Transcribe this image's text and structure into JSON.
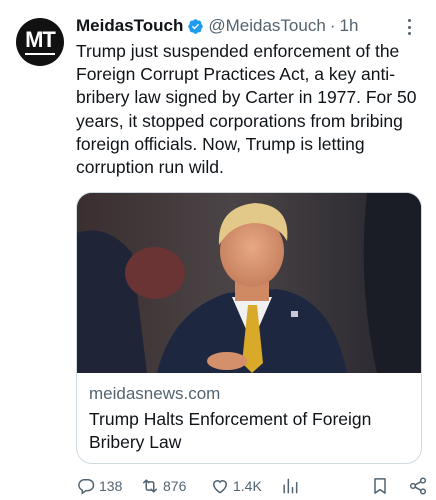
{
  "author": {
    "name": "MeidasTouch",
    "handle": "@MeidasTouch",
    "separator": "·",
    "time": "1h",
    "avatar_text": "MT",
    "verified_color": "#1d9bf0"
  },
  "tweet": {
    "text": "Trump just suspended enforcement of the Foreign Corrupt Practices Act, a key anti-bribery law signed by Carter in 1977. For 50 years, it stopped corporations from bribing foreign officials. Now, Trump is letting corruption run wild."
  },
  "card": {
    "domain": "meidasnews.com",
    "title": "Trump Halts Enforcement of Foreign Bribery Law"
  },
  "actions": {
    "reply_count": "138",
    "retweet_count": "876",
    "like_count": "1.4K",
    "views_icon": "chart-bar-icon",
    "bookmark_icon": "bookmark-icon",
    "share_icon": "share-icon"
  },
  "colors": {
    "text_primary": "#0f1419",
    "text_secondary": "#536471",
    "border": "#cfd9de"
  }
}
